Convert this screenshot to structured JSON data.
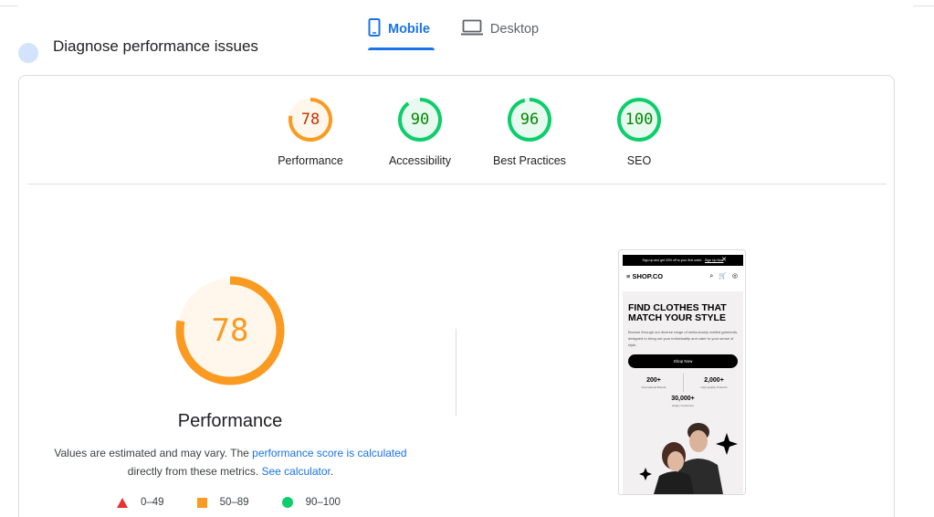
{
  "device_tabs": [
    {
      "label": "Mobile",
      "icon": "phone-icon",
      "active": true
    },
    {
      "label": "Desktop",
      "icon": "laptop-icon",
      "active": false
    }
  ],
  "section_heading": "Diagnose performance issues",
  "categories": [
    {
      "label": "Performance",
      "score": "78",
      "status": "average",
      "fraction": 0.78
    },
    {
      "label": "Accessibility",
      "score": "90",
      "status": "pass",
      "fraction": 0.9
    },
    {
      "label": "Best Practices",
      "score": "96",
      "status": "pass",
      "fraction": 0.96
    },
    {
      "label": "SEO",
      "score": "100",
      "status": "pass",
      "fraction": 1.0
    }
  ],
  "performance": {
    "score": "78",
    "fraction": 0.78,
    "title": "Performance",
    "desc_part1": "Values are estimated and may vary. The ",
    "desc_link1": "performance score is calculated",
    "desc_part2": " directly from these metrics. ",
    "desc_link2": "See calculator",
    "desc_part3": "."
  },
  "legend": [
    {
      "shape": "triangle",
      "label": "0–49"
    },
    {
      "shape": "square",
      "label": "50–89"
    },
    {
      "shape": "circle",
      "label": "90–100"
    }
  ],
  "colors": {
    "accent": "#1a73e8",
    "average": "#fa9a20",
    "average_bg": "#fff7ec",
    "average_text": "#c33300",
    "pass": "#0cce6b",
    "pass_bg": "#e8faf0",
    "pass_text": "#008800",
    "fail": "#ea3232"
  },
  "screenshot": {
    "promo_text": "Sign up and get 20% off to your first order.",
    "promo_link": "Sign Up Now",
    "logo": "SHOP.CO",
    "nav_icons": "⌕ 🛒 ◎",
    "hero_title": "FIND CLOTHES THAT MATCH YOUR STYLE",
    "hero_desc": "Browse through our diverse range of meticulously crafted garments, designed to bring out your individuality and cater to your sense of style.",
    "cta": "Shop Now",
    "stats": [
      {
        "value": "200+",
        "label": "International Brands"
      },
      {
        "value": "2,000+",
        "label": "High-Quality Products"
      },
      {
        "value": "30,000+",
        "label": "Happy Customers"
      }
    ]
  }
}
